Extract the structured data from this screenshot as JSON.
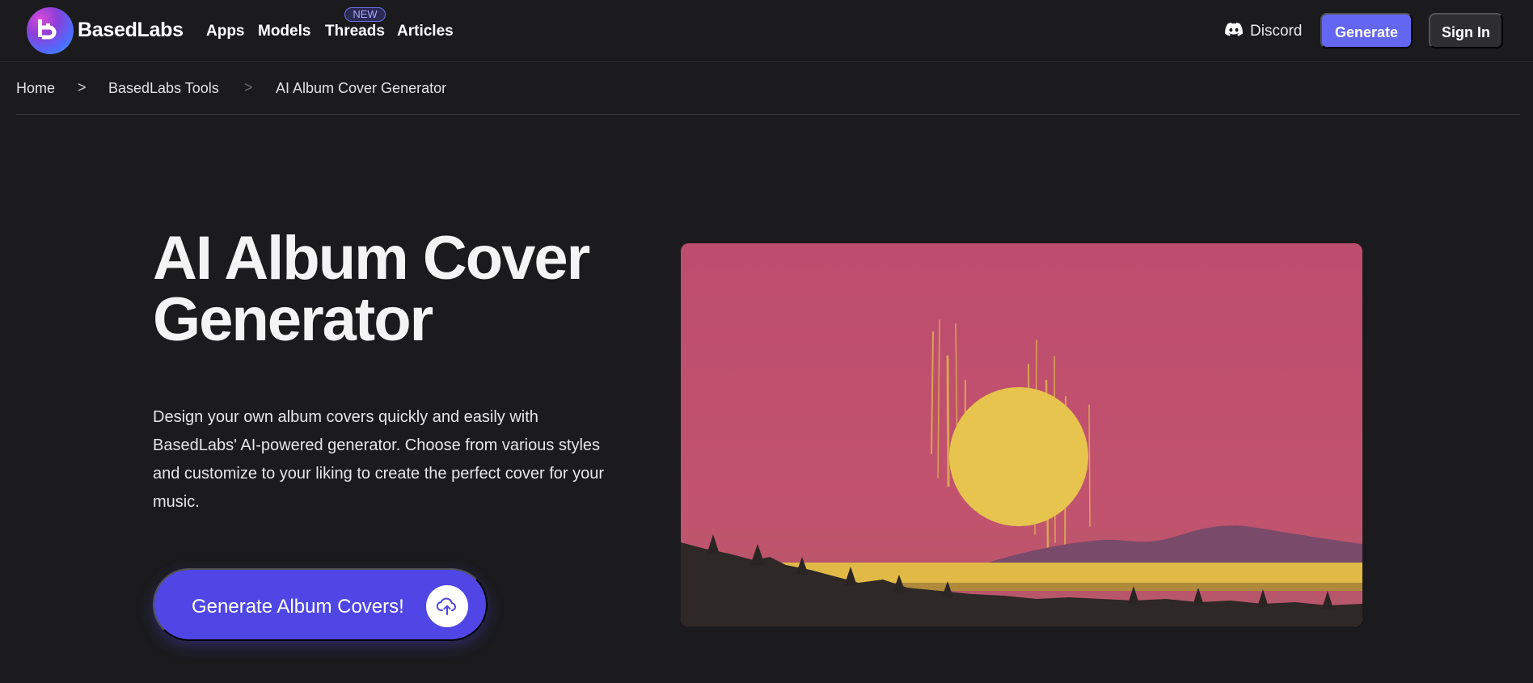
{
  "nav": {
    "brand": "BasedLabs",
    "links": [
      {
        "label": "Apps"
      },
      {
        "label": "Models"
      },
      {
        "label": "Threads",
        "badge": "NEW"
      },
      {
        "label": "Articles"
      }
    ],
    "discord_label": "Discord",
    "discord_icon": "discord-icon",
    "generate_label": "Generate",
    "signin_label": "Sign In"
  },
  "breadcrumb": {
    "items": [
      "Home",
      "BasedLabs Tools",
      "AI Album Cover Generator"
    ],
    "separator": ">"
  },
  "hero": {
    "title": "AI Album Cover Generator",
    "description": "Design your own album covers quickly and easily with BasedLabs' AI-powered generator. Choose from various styles and customize to your liking to create the perfect cover for your music.",
    "cta_label": "Generate Album Covers!",
    "cta_icon": "cloud-upload-icon",
    "image": "pink-sky-yellow-sun-landscape"
  },
  "colors": {
    "background": "#1b1b1d",
    "accent": "#6366f1",
    "cta": "#4f46e5",
    "image_sky": "#b94c6c",
    "image_sun": "#e6c44e"
  }
}
